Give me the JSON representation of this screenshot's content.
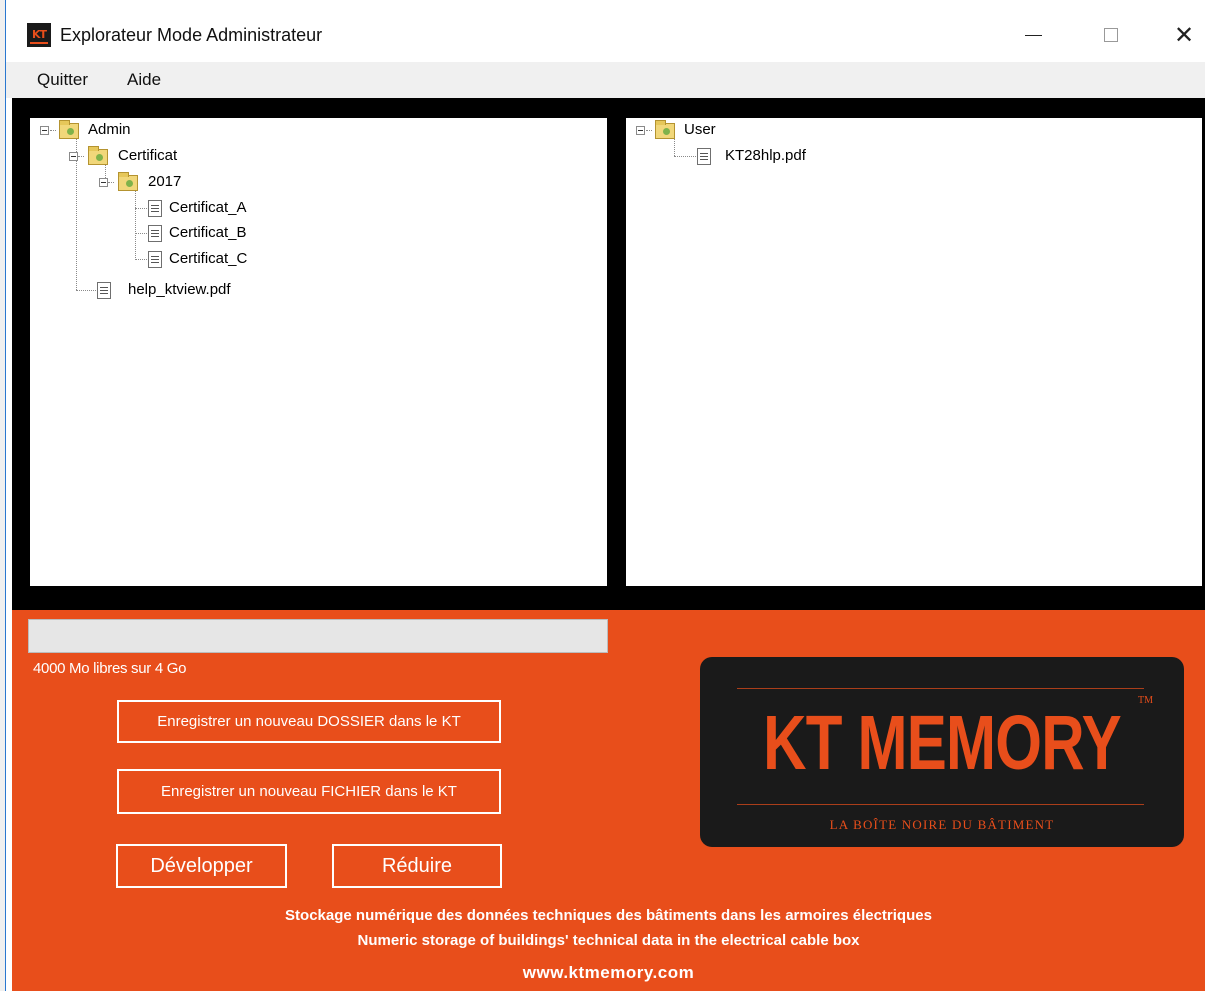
{
  "window": {
    "title": "Explorateur Mode Administrateur",
    "icon": "kt-app-icon",
    "icon_text": "KT"
  },
  "menu": {
    "quit": "Quitter",
    "help": "Aide"
  },
  "admin_tree": {
    "root": "Admin",
    "certificat": "Certificat",
    "year": "2017",
    "files": [
      "Certificat_A",
      "Certificat_B",
      "Certificat_C"
    ],
    "help_file": "help_ktview.pdf"
  },
  "user_tree": {
    "root": "User",
    "file": "KT28hlp.pdf"
  },
  "storage": {
    "progress_percent": 0,
    "free_text": "4000 Mo libres sur 4 Go"
  },
  "buttons": {
    "new_folder": "Enregistrer un nouveau DOSSIER dans le KT",
    "new_file": "Enregistrer un nouveau FICHIER dans le KT",
    "expand": "Développer",
    "collapse": "Réduire"
  },
  "logo": {
    "main": "KT MEMORY",
    "tm": "TM",
    "tagline": "LA BOÎTE NOIRE DU BÂTIMENT"
  },
  "footer": {
    "line1": "Stockage numérique des données techniques des bâtiments dans les armoires électriques",
    "line2": "Numeric storage of buildings' technical data in the electrical cable box",
    "url": "www.ktmemory.com"
  },
  "colors": {
    "brand_orange": "#e84e1b",
    "logo_bg": "#1a1a1a",
    "panel_black": "#000000"
  }
}
